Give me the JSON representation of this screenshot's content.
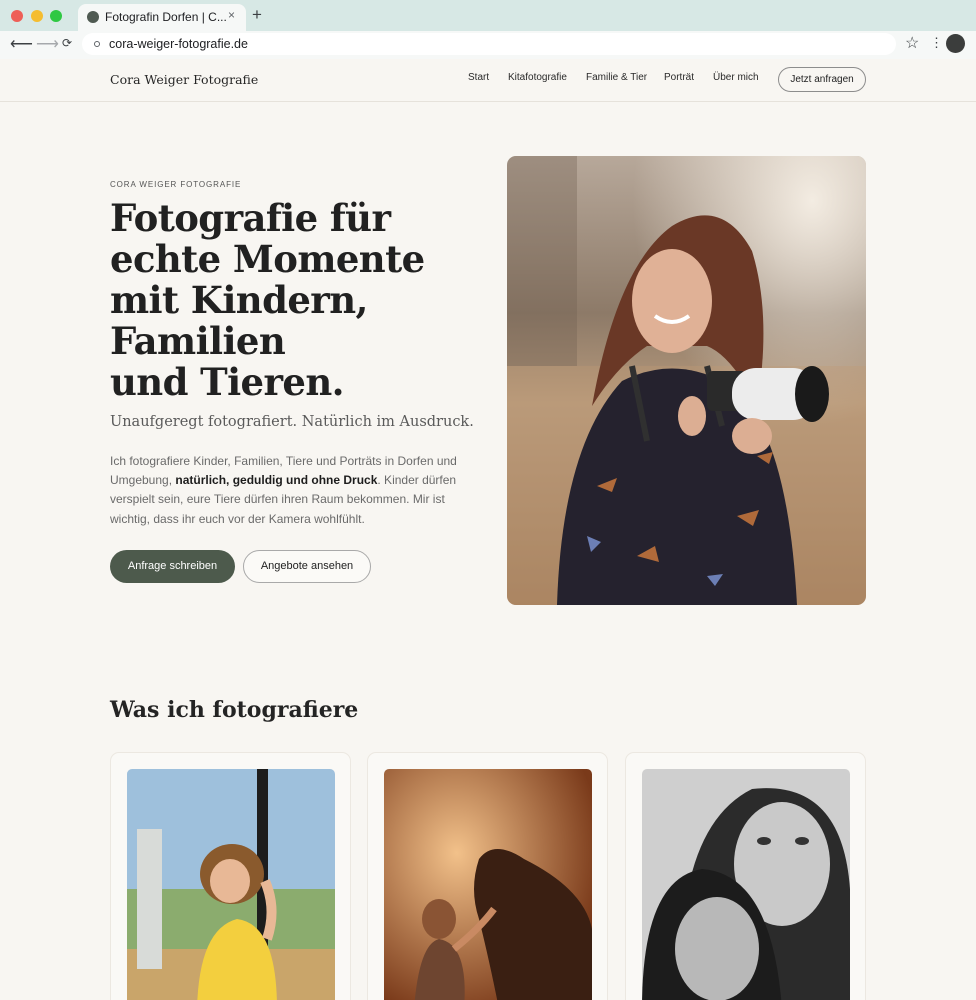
{
  "browser": {
    "tab_title": "Fotografin Dorfen | C...",
    "tab_close": "×",
    "new_tab": "+",
    "url": "cora-weiger-fotografie.de",
    "back": "⟵",
    "forward": "⟶",
    "reload": "⟳",
    "star": "☆",
    "menu": "⋮"
  },
  "header": {
    "brand": "Cora Weiger Fotografie",
    "nav": [
      "Start",
      "Kitafotografie",
      "Familie & Tier",
      "Porträt",
      "Über mich"
    ],
    "cta": "Jetzt anfragen"
  },
  "hero": {
    "eyebrow": "CORA WEIGER FOTOGRAFIE",
    "title_lines": [
      "Fotografie für",
      "echte Momente",
      "mit Kindern,",
      "Familien",
      "und Tieren."
    ],
    "subtitle": "Unaufgeregt fotografiert. Natürlich im Ausdruck.",
    "body_before": "Ich fotografiere Kinder, Familien, Tiere und Porträts in Dorfen und Umgebung, ",
    "body_strong": "natürlich, geduldig und ohne Druck",
    "body_after": ". Kinder dürfen verspielt sein, eure Tiere dürfen ihren Raum bekommen. Mir ist wichtig, dass ihr euch vor der Kamera wohlfühlt.",
    "primary_button": "Anfrage schreiben",
    "secondary_button": "Angebote ansehen"
  },
  "services": {
    "title": "Was ich fotografiere"
  },
  "colors": {
    "background": "#f8f6f2",
    "accent": "#4d5a4c",
    "chrome": "#d7e8e5"
  }
}
